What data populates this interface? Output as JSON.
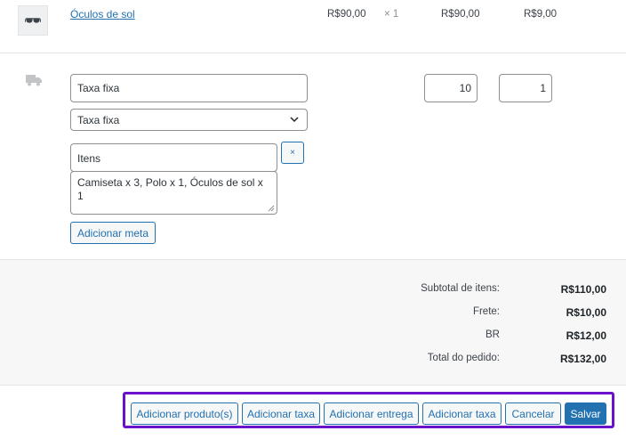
{
  "product": {
    "name": "Óculos de sol",
    "cost": "R$90,00",
    "qty": "× 1",
    "total": "R$90,00",
    "tax": "R$9,00",
    "icon": "sunglasses-icon"
  },
  "shipping": {
    "icon": "truck-icon",
    "name_value": "Taxa fixa",
    "method_selected": "Taxa fixa",
    "meta_key": "Itens",
    "meta_value": "Camiseta x 3, Polo x 1, Óculos de sol x 1",
    "remove_label": "×",
    "add_meta_label": "Adicionar meta",
    "cost": "10",
    "tax": "1"
  },
  "totals": {
    "items_label": "Subtotal de itens:",
    "items_value": "R$110,00",
    "shipping_label": "Frete:",
    "shipping_value": "R$10,00",
    "tax_label": "BR",
    "tax_value": "R$12,00",
    "order_label": "Total do pedido:",
    "order_value": "R$132,00"
  },
  "actions": {
    "add_product": "Adicionar produto(s)",
    "add_fee": "Adicionar taxa",
    "add_shipping": "Adicionar entrega",
    "add_tax": "Adicionar taxa",
    "cancel": "Cancelar",
    "save": "Salvar"
  },
  "colors": {
    "link": "#2271b1",
    "highlight": "#6a12c9"
  }
}
